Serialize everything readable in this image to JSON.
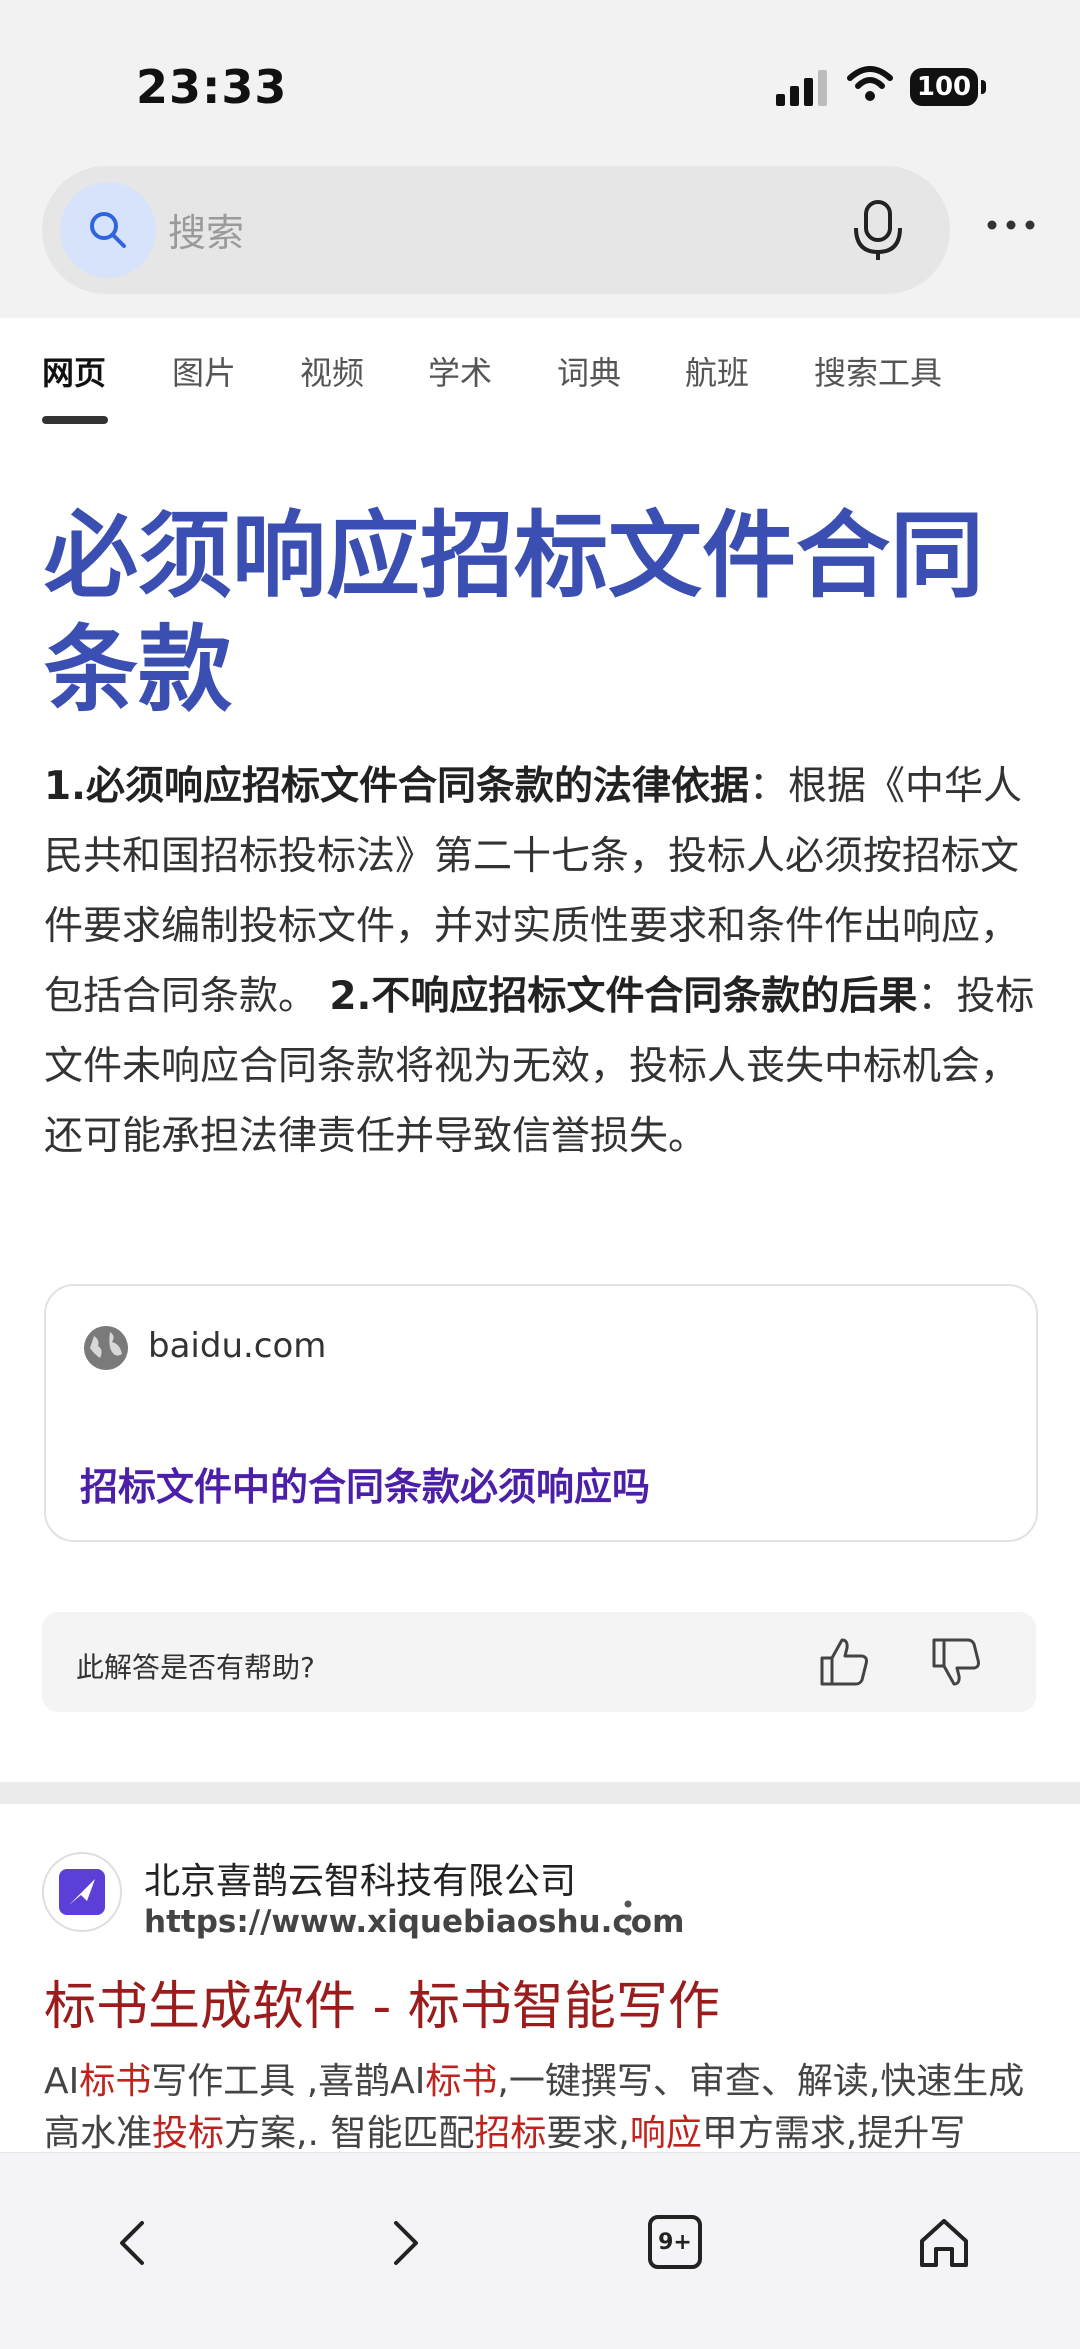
{
  "status_bar": {
    "time": "23:33",
    "battery": "100"
  },
  "search": {
    "placeholder": "搜索"
  },
  "tabs": [
    {
      "label": "网页",
      "active": true
    },
    {
      "label": "图片"
    },
    {
      "label": "视频"
    },
    {
      "label": "学术"
    },
    {
      "label": "词典"
    },
    {
      "label": "航班"
    },
    {
      "label": "搜索工具"
    }
  ],
  "answer": {
    "title": "必须响应招标文件合同条款",
    "p1_heading": "1.必须响应招标文件合同条款的法律依据",
    "p1_text": "：根据《中华人民共和国招标投标法》第二十七条，投标人必须按招标文件要求编制投标文件，并对实质性要求和条件作出响应，包括合同条款。",
    "p2_heading": "2.不响应招标文件合同条款的后果",
    "p2_text": "：投标文件未响应合同条款将视为无效，投标人丧失中标机会，还可能承担法律责任并导致信誉损失。"
  },
  "source": {
    "domain": "baidu.com",
    "link_text": "招标文件中的合同条款必须响应吗"
  },
  "feedback": {
    "question": "此解答是否有帮助?"
  },
  "result": {
    "site_name": "北京喜鹊云智科技有限公司",
    "url": "https://www.xiquebiaoshu.com",
    "title_hl1": "标书",
    "title_mid": "生成软件 - ",
    "title_hl2": "标书",
    "title_end": "智能写作",
    "snippet_parts": [
      "AI",
      "标书",
      "写作工具 ,喜鹊AI",
      "标书",
      ",一键撰写、审查、解读,快速生成高水准",
      "投标",
      "方案,. 智能匹配",
      "招标",
      "要求,",
      "响应",
      "甲方需求,提升写"
    ]
  },
  "bottom_nav": {
    "tab_count": "9+"
  },
  "colors": {
    "title_blue": "#3a4fb1",
    "link_purple": "#4b1fa8",
    "highlight_red": "#c0231d"
  }
}
